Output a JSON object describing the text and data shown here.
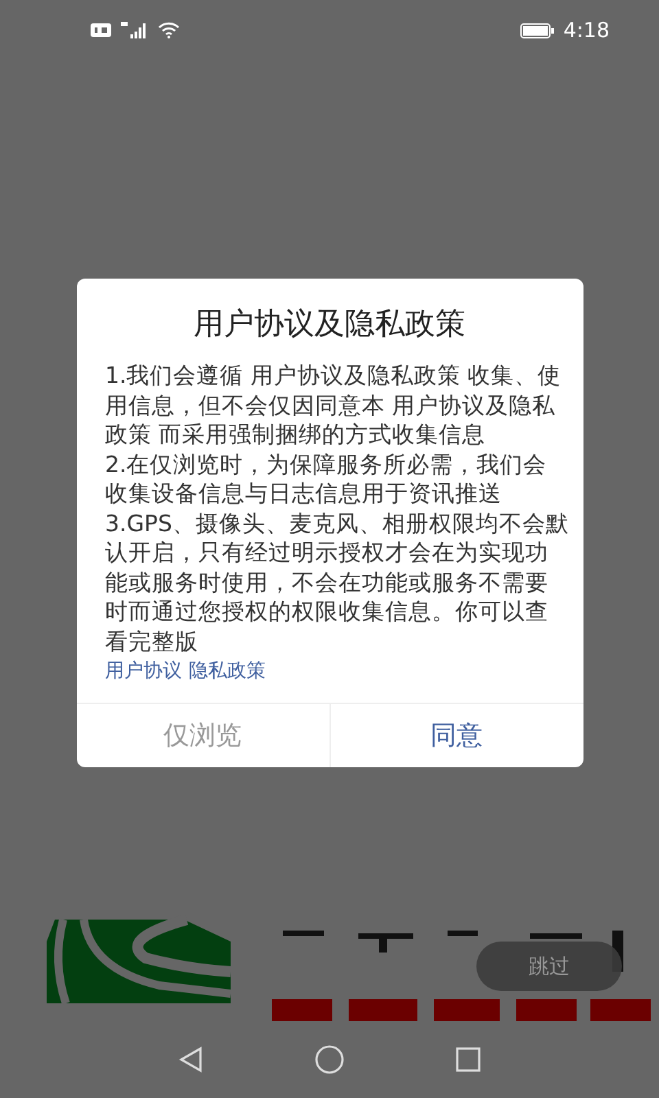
{
  "status_bar": {
    "time": "4:18"
  },
  "dialog": {
    "title": "用户协议及隐私政策",
    "paragraphs": [
      "1.我们会遵循 用户协议及隐私政策 收集、使用信息，但不会仅因同意本 用户协议及隐私政策 而采用强制捆绑的方式收集信息",
      "2.在仅浏览时，为保障服务所必需，我们会收集设备信息与日志信息用于资讯推送",
      "3.GPS、摄像头、麦克风、相册权限均不会默认开启，只有经过明示授权才会在为实现功能或服务时使用，不会在功能或服务不需要时而通过您授权的权限收集信息。你可以查看完整版"
    ],
    "links": [
      "用户协议",
      "隐私政策"
    ],
    "buttons": [
      {
        "label": "仅浏览",
        "kind": "secondary"
      },
      {
        "label": "同意",
        "kind": "primary"
      }
    ]
  },
  "skip_button": {
    "label": "跳过"
  }
}
